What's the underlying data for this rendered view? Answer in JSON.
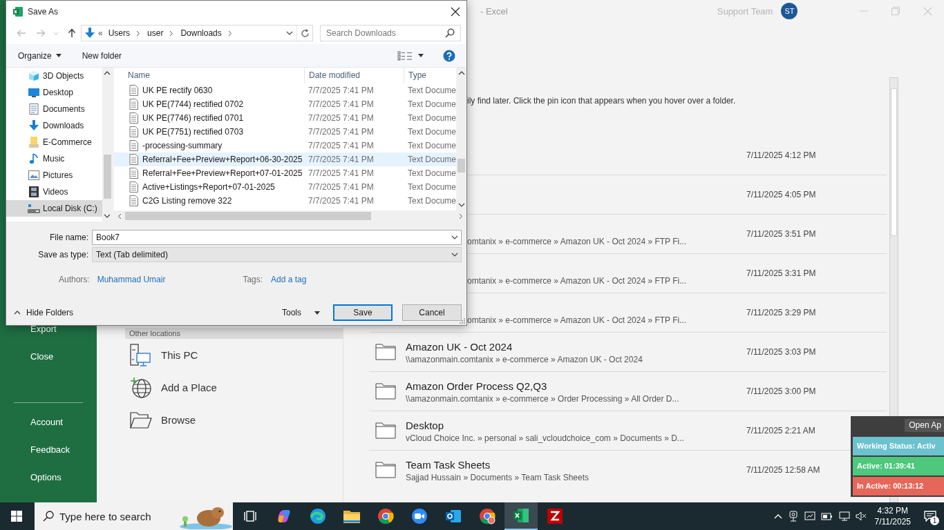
{
  "excel": {
    "title": "- Excel",
    "user_name": "Support Team",
    "avatar": "ST",
    "sidebar_top": [
      "Export",
      "Close"
    ],
    "sidebar_bottom": [
      "Account",
      "Feedback",
      "Options"
    ],
    "locations_header": "Other locations",
    "locations": [
      {
        "kind": "pc",
        "label": "This PC"
      },
      {
        "kind": "add",
        "label": "Add a Place"
      },
      {
        "kind": "browse",
        "label": "Browse"
      }
    ],
    "pin_hint": "ily find later. Click the pin icon that appears when you hover over a folder.",
    "recent": [
      {
        "kind": "partial",
        "date": "7/11/2025 4:12 PM"
      },
      {
        "kind": "partial",
        "date": "7/11/2025 4:05 PM"
      },
      {
        "kind": "partial",
        "path": "omtanix » e-commerce » Amazon UK - Oct 2024 » FTP Fi...",
        "date": "7/11/2025 3:51 PM"
      },
      {
        "kind": "partial",
        "path": "omtanix » e-commerce » Amazon UK - Oct 2024 » FTP Fi...",
        "date": "7/11/2025 3:31 PM"
      },
      {
        "kind": "partial",
        "path": "omtanix » e-commerce » Amazon UK - Oct 2024 » FTP Fi...",
        "date": "7/11/2025 3:29 PM"
      },
      {
        "kind": "full",
        "name": "Amazon UK - Oct 2024",
        "path": "\\\\amazonmain.comtanix » e-commerce » Amazon UK - Oct 2024",
        "date": "7/11/2025 3:03 PM"
      },
      {
        "kind": "full",
        "name": "Amazon Order Process Q2,Q3",
        "path": "\\\\amazonmain.comtanix » e-commerce » Order Processing » All Order D...",
        "date": "7/11/2025 3:00 PM"
      },
      {
        "kind": "full",
        "name": "Desktop",
        "path": "vCloud Choice Inc. » personal » sali_vcloudchoice_com » Documents » D...",
        "date": "7/11/2025 2:21 AM"
      },
      {
        "kind": "full",
        "name": "Team Task Sheets",
        "path": "Sajjad Hussain » Documents » Team Task Sheets",
        "date": "7/11/2025 12:58 AM"
      }
    ]
  },
  "dialog": {
    "title": "Save As",
    "breadcrumb_overflow": "«",
    "breadcrumb": [
      "Users",
      "user",
      "Downloads"
    ],
    "search": {
      "placeholder": "Search Downloads"
    },
    "organize": "Organize",
    "new_folder": "New folder",
    "nav": [
      {
        "kind": "objects",
        "label": "3D Objects",
        "selected": false
      },
      {
        "kind": "desktop",
        "label": "Desktop",
        "selected": false
      },
      {
        "kind": "documents",
        "label": "Documents",
        "selected": false
      },
      {
        "kind": "downloads",
        "label": "Downloads",
        "selected": false
      },
      {
        "kind": "folder",
        "label": "E-Commerce",
        "selected": false
      },
      {
        "kind": "music",
        "label": "Music",
        "selected": false
      },
      {
        "kind": "pictures",
        "label": "Pictures",
        "selected": false
      },
      {
        "kind": "videos",
        "label": "Videos",
        "selected": false
      },
      {
        "kind": "drive",
        "label": "Local Disk (C:)",
        "selected": true
      }
    ],
    "columns": [
      "Name",
      "Date modified",
      "Type"
    ],
    "files": [
      {
        "name": "UK PE rectify 0630",
        "date": "7/7/2025 7:41 PM",
        "type": "Text Docume",
        "selected": false
      },
      {
        "name": "UK PE(7744) rectified 0702",
        "date": "7/7/2025 7:41 PM",
        "type": "Text Docume",
        "selected": false
      },
      {
        "name": "UK PE(7746) rectified 0701",
        "date": "7/7/2025 7:41 PM",
        "type": "Text Docume",
        "selected": false
      },
      {
        "name": "UK PE(7751) rectified 0703",
        "date": "7/7/2025 7:41 PM",
        "type": "Text Docume",
        "selected": false
      },
      {
        "name": "-processing-summary",
        "date": "7/7/2025 7:41 PM",
        "type": "Text Docume",
        "selected": false
      },
      {
        "name": "Referral+Fee+Preview+Report+06-30-2025",
        "date": "7/7/2025 7:41 PM",
        "type": "Text Docume",
        "selected": true
      },
      {
        "name": "Referral+Fee+Preview+Report+07-01-2025",
        "date": "7/7/2025 7:41 PM",
        "type": "Text Docume",
        "selected": false
      },
      {
        "name": "Active+Listings+Report+07-01-2025",
        "date": "7/7/2025 7:41 PM",
        "type": "Text Docume",
        "selected": false
      },
      {
        "name": "C2G Listing remove 322",
        "date": "7/7/2025 7:41 PM",
        "type": "Text Docume",
        "selected": false
      }
    ],
    "file_name_label": "File name:",
    "file_name": "Book7",
    "save_type_label": "Save as type:",
    "save_type": "Text (Tab delimited)",
    "authors_label": "Authors:",
    "authors": "Muhammad Umair",
    "tags_label": "Tags:",
    "tags": "Add a tag",
    "hide_folders": "Hide Folders",
    "tools": "Tools",
    "buttons": [
      {
        "kind": "default",
        "label": "Save"
      },
      {
        "kind": "normal",
        "label": "Cancel"
      }
    ]
  },
  "widget": {
    "button": "Open Ap",
    "status": [
      {
        "text": "Working Status: Activ",
        "color": "#6cc2ce"
      },
      {
        "text": "Active: 01:39:41",
        "color": "#4dc87c"
      },
      {
        "text": "In Active: 00:13:12",
        "color": "#e4675a"
      }
    ]
  },
  "taskbar": {
    "search_placeholder": "Type here to search",
    "apps": [
      {
        "kind": "taskview",
        "active": false
      },
      {
        "kind": "copilot",
        "active": false
      },
      {
        "kind": "edge",
        "active": false
      },
      {
        "kind": "explorer",
        "active": false
      },
      {
        "kind": "chrome",
        "active": false
      },
      {
        "kind": "zoom",
        "active": false
      },
      {
        "kind": "outlook",
        "active": false
      },
      {
        "kind": "chrome-profile",
        "active": false
      },
      {
        "kind": "excel",
        "active": true
      },
      {
        "kind": "filezilla",
        "active": false
      }
    ],
    "time": "4:32 PM",
    "date": "7/11/2025",
    "notifications": "1"
  }
}
